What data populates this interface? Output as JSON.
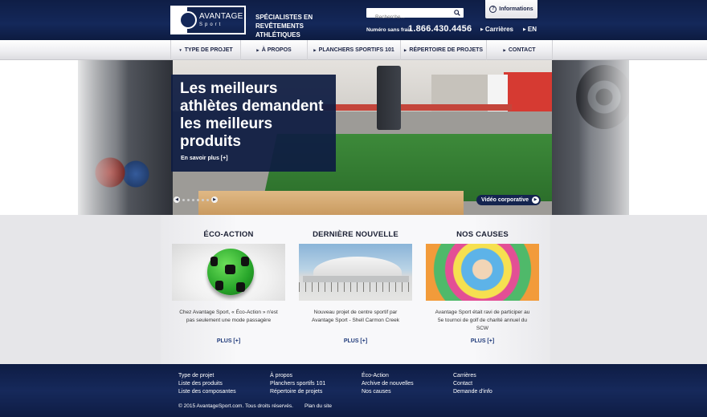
{
  "header": {
    "logo_name": "AVANTAGE",
    "logo_sub": "Sport",
    "tagline_l1": "SPÉCIALISTES EN",
    "tagline_l2": "REVÊTEMENTS ATHLÉTIQUES",
    "search_placeholder": "Recherche...",
    "phone_label": "Numéro sans frais",
    "phone_number": "1.866.430.4456",
    "careers": "Carrières",
    "language": "EN",
    "info_tab": "Informations",
    "brand_color": "#14285a"
  },
  "nav": {
    "items": [
      {
        "label": "TYPE DE PROJET",
        "arrow": "down"
      },
      {
        "label": "À PROPOS",
        "arrow": "right"
      },
      {
        "label": "PLANCHERS SPORTIFS 101",
        "arrow": "right"
      },
      {
        "label": "RÉPERTOIRE DE PROJETS",
        "arrow": "right"
      },
      {
        "label": "CONTACT",
        "arrow": "right"
      }
    ]
  },
  "hero": {
    "title": "Les meilleurs athlètes demandent les meilleurs produits",
    "more": "En savoir plus [+]",
    "video": "Vidéo corporative",
    "slide_count": 6
  },
  "columns": [
    {
      "title": "ÉCO-ACTION",
      "text": "Chez Avantage Sport, « Éco-Action » n'est pas seulement une mode passagère",
      "more": "PLUS [+]",
      "image": "green-soccer-ball"
    },
    {
      "title": "DERNIÈRE NOUVELLE",
      "text": "Nouveau projet de centre sportif par Avantage Sport - Shell Carmon Creek",
      "more": "PLUS [+]",
      "image": "dome-building"
    },
    {
      "title": "NOS CAUSES",
      "text": "Avantage Sport était ravi de participer au 5e tournoi de golf de charité annuel du SCW",
      "more": "PLUS [+]",
      "image": "children-circle"
    }
  ],
  "footer": {
    "col1": [
      "Type de projet",
      "Liste des produits",
      "Liste des composantes"
    ],
    "col2": [
      "À propos",
      "Planchers sportifs 101",
      "Répertoire de projets"
    ],
    "col3": [
      "Éco-Action",
      "Archive de nouvelles",
      "Nos causes"
    ],
    "col4": [
      "Carrières",
      "Contact",
      "Demande d'info"
    ],
    "copyright": "© 2015 AvantageSport.com. Tous droits réservés.",
    "sitemap": "Plan du site"
  }
}
